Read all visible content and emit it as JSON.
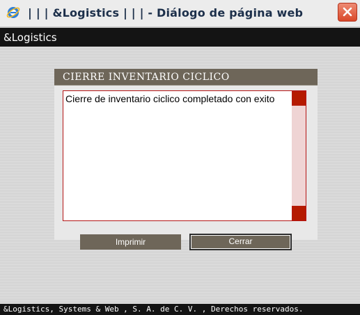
{
  "window": {
    "title": "| | | &Logistics | | | - Diálogo de página web",
    "icon": "internet-explorer-icon",
    "close_icon": "close-icon"
  },
  "app": {
    "name": "&Logistics"
  },
  "dialog": {
    "title": "CIERRE INVENTARIO CICLICO",
    "message": "Cierre de inventario ciclico completado con exito"
  },
  "buttons": {
    "print_label": "Imprimir",
    "close_label": "Cerrar"
  },
  "footer": {
    "text": "&Logistics, Systems & Web , S. A. de C. V. , Derechos reservados."
  },
  "colors": {
    "accent_brown": "#6e6659",
    "scroll_red": "#b51a00",
    "border_red": "#b41414",
    "header_black": "#141414"
  }
}
